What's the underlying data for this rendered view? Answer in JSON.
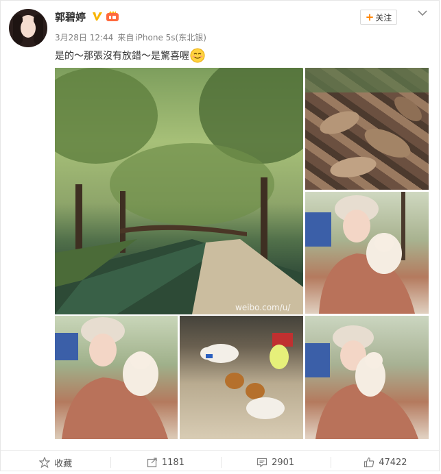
{
  "post": {
    "username": "郭碧婷",
    "timestamp": "3月28日 12:44",
    "source_prefix": "来自",
    "source": "iPhone 5s(东北银)",
    "content": "是的～那張沒有放錯～是驚喜喔",
    "follow_label": "关注",
    "watermark": "weibo.com/u/"
  },
  "icons": {
    "verified": "verified-v-icon",
    "vip": "vip-badge-icon",
    "emoji": "smile-emoji-icon",
    "menu": "chevron-down-icon",
    "favorite": "star-icon",
    "repost": "share-icon",
    "comment": "comment-icon",
    "like": "thumbs-up-icon"
  },
  "images": [
    {
      "alt": "tree-lined canal with footbridge"
    },
    {
      "alt": "dry fallen leaves"
    },
    {
      "alt": "woman in fur hat holding small dog"
    },
    {
      "alt": "woman in fur hat holding small dog"
    },
    {
      "alt": "dogs on dirt ground"
    },
    {
      "alt": "woman in fur hat holding small dog"
    }
  ],
  "actions": {
    "favorite_label": "收藏",
    "repost_count": "1181",
    "comment_count": "2901",
    "like_count": "47422"
  },
  "colors": {
    "accent": "#ff8200",
    "verified": "#f8b500",
    "text": "#333333",
    "meta": "#808080"
  }
}
